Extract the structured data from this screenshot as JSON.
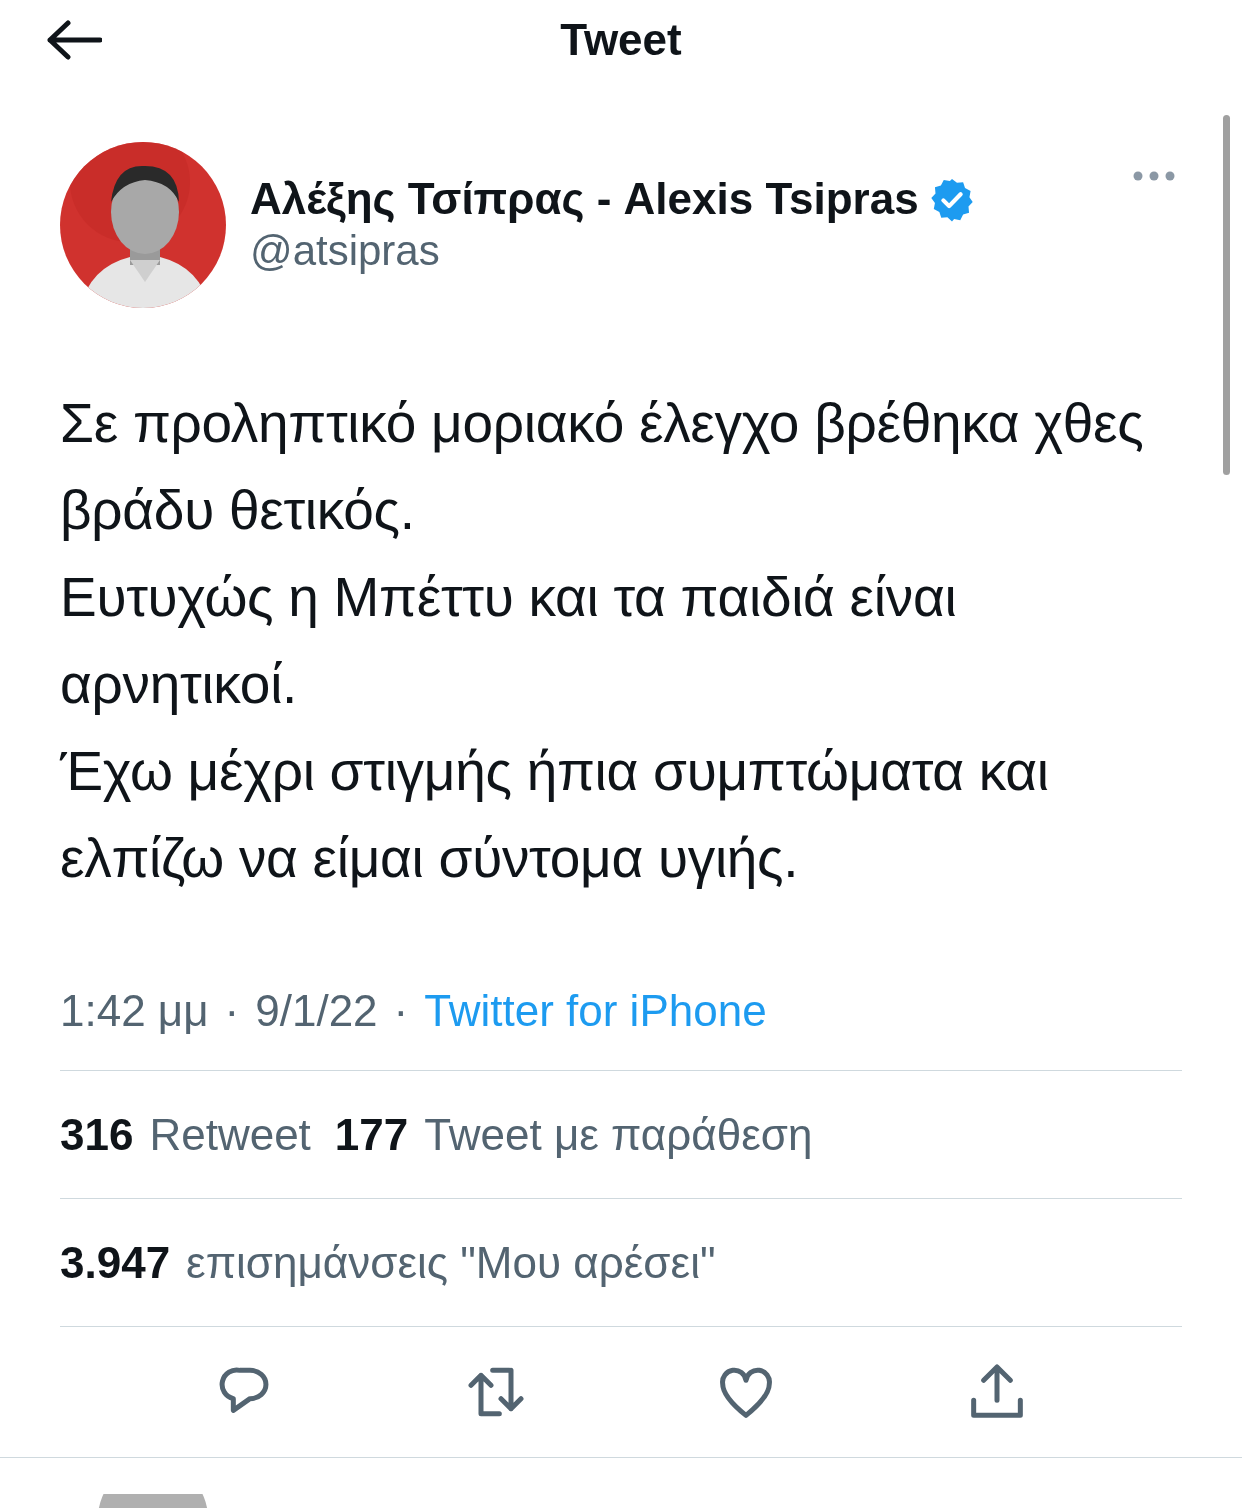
{
  "header": {
    "title": "Tweet"
  },
  "tweet": {
    "author": {
      "name": "Αλέξης Τσίπρας - Alexis Tsipras",
      "verified": true,
      "handle": "@atsipras"
    },
    "paragraphs": [
      "Σε προληπτικό μοριακό έλεγχο βρέθηκα χθες βράδυ θετικός.",
      "Ευτυχώς η Μπέττυ και τα παιδιά είναι αρνητικοί.",
      "Έχω μέχρι στιγμής ήπια συμπτώματα και ελπίζω να είμαι σύντομα υγιής."
    ],
    "time": "1:42 μμ",
    "date": "9/1/22",
    "separator": "·",
    "source": "Twitter for iPhone",
    "stats_rows": [
      [
        {
          "count": "316",
          "label": "Retweet"
        },
        {
          "count": "177",
          "label": "Tweet με παράθεση"
        }
      ],
      [
        {
          "count": "3.947",
          "label": "επισημάνσεις \"Μου αρέσει\""
        }
      ]
    ],
    "actions": [
      {
        "kind": "reply"
      },
      {
        "kind": "retweet"
      },
      {
        "kind": "like"
      },
      {
        "kind": "share"
      }
    ]
  }
}
